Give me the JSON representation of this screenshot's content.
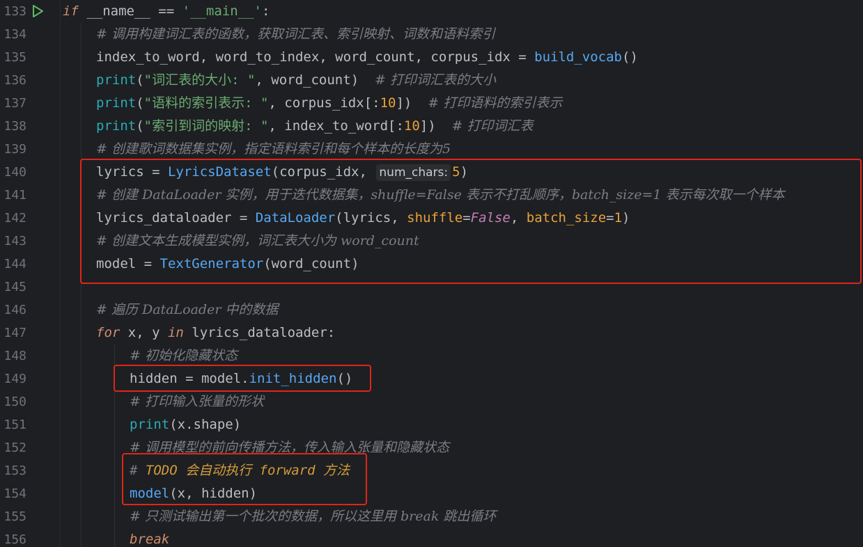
{
  "lines": [
    {
      "n": "133"
    },
    {
      "n": "134"
    },
    {
      "n": "135"
    },
    {
      "n": "136"
    },
    {
      "n": "137"
    },
    {
      "n": "138"
    },
    {
      "n": "139"
    },
    {
      "n": "140"
    },
    {
      "n": "141"
    },
    {
      "n": "142"
    },
    {
      "n": "143"
    },
    {
      "n": "144"
    },
    {
      "n": "145"
    },
    {
      "n": "146"
    },
    {
      "n": "147"
    },
    {
      "n": "148"
    },
    {
      "n": "149"
    },
    {
      "n": "150"
    },
    {
      "n": "151"
    },
    {
      "n": "152"
    },
    {
      "n": "153"
    },
    {
      "n": "154"
    },
    {
      "n": "155"
    },
    {
      "n": "156"
    }
  ],
  "code": {
    "l133": {
      "kw": "if",
      "a": " __name__ == ",
      "s": "'__main__'",
      "b": ":"
    },
    "l134": {
      "c": "# 调用构建词汇表的函数，获取词汇表、索引映射、词数和语料索引"
    },
    "l135": {
      "a": "index_to_word, word_to_index, word_count, corpus_idx = ",
      "f": "build_vocab",
      "b": "()"
    },
    "l136": {
      "f": "print",
      "a": "(",
      "s": "\"词汇表的大小: \"",
      "b": ", word_count)  ",
      "c": "# 打印词汇表的大小"
    },
    "l137": {
      "f": "print",
      "a": "(",
      "s": "\"语料的索引表示: \"",
      "b": ", corpus_idx[:",
      "num": "10",
      "d": "])  ",
      "c": "# 打印语料的索引表示"
    },
    "l138": {
      "f": "print",
      "a": "(",
      "s": "\"索引到词的映射: \"",
      "b": ", index_to_word[:",
      "num": "10",
      "d": "])  ",
      "c": "# 打印词汇表"
    },
    "l139": {
      "c": "# 创建歌词数据集实例，指定语料索引和每个样本的长度为5"
    },
    "l140": {
      "a": "lyrics = ",
      "f": "LyricsDataset",
      "b": "(corpus_idx, ",
      "hint": "num_chars:",
      "num": "5",
      "d": ")"
    },
    "l141": {
      "c": "# 创建 DataLoader 实例，用于迭代数据集，shuffle=False 表示不打乱顺序，batch_size=1 表示每次取一个样本"
    },
    "l142": {
      "a": "lyrics_dataloader = ",
      "f": "DataLoader",
      "b": "(lyrics, ",
      "k1": "shuffle",
      "e1": "=",
      "v1": "False",
      "c1": ", ",
      "k2": "batch_size",
      "e2": "=",
      "v2": "1",
      "d": ")"
    },
    "l143": {
      "c": "# 创建文本生成模型实例，词汇表大小为 word_count"
    },
    "l144": {
      "a": "model = ",
      "f": "TextGenerator",
      "b": "(word_count)"
    },
    "l145": {},
    "l146": {
      "c": "# 遍历 DataLoader 中的数据"
    },
    "l147": {
      "kw": "for",
      "a": " x, y ",
      "kw2": "in",
      "b": " lyrics_dataloader:"
    },
    "l148": {
      "c": "# 初始化隐藏状态"
    },
    "l149": {
      "a": "hidden = model.",
      "f": "init_hidden",
      "b": "()"
    },
    "l150": {
      "c": "# 打印输入张量的形状"
    },
    "l151": {
      "f": "print",
      "b": "(x.shape)"
    },
    "l152": {
      "c": "# 调用模型的前向传播方法，传入输入张量和隐藏状态"
    },
    "l153": {
      "hash": "# ",
      "todo": "TODO 会自动执行 forward 方法"
    },
    "l154": {
      "f": "model",
      "b": "(x, hidden)"
    },
    "l155": {
      "c": "# 只测试输出第一个批次的数据，所以这里用 break 跳出循环"
    },
    "l156": {
      "kw": "break"
    }
  },
  "colors": {
    "background": "#1e1f22",
    "highlight_box": "#e0251b"
  }
}
